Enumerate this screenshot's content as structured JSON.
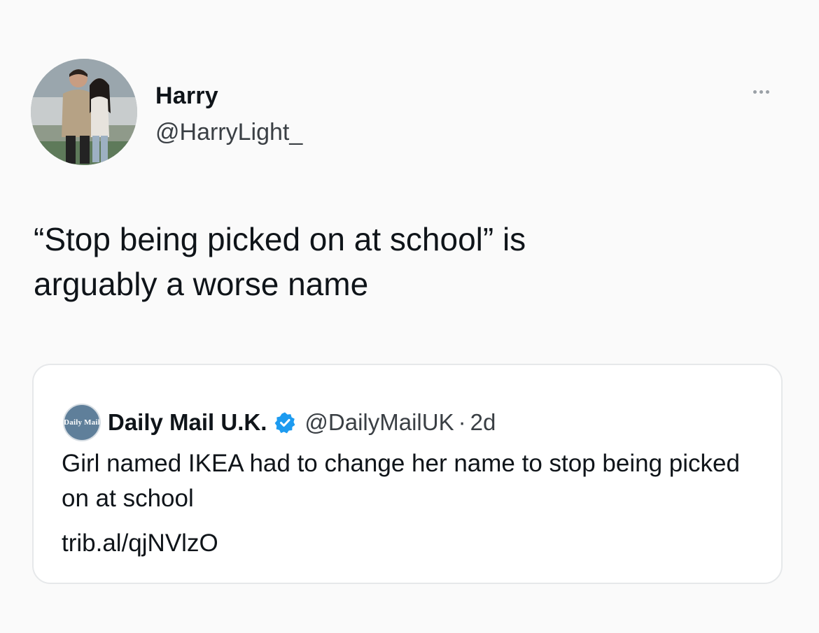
{
  "tweet": {
    "author": {
      "name": "Harry",
      "handle": "@HarryLight_"
    },
    "text": "“Stop being picked on at school” is\narguably a worse name",
    "quoted": {
      "author": {
        "name": "Daily Mail U.K.",
        "avatar_text": "Daily Mail",
        "verified": true,
        "handle": "@DailyMailUK",
        "separator": "·",
        "time": "2d"
      },
      "text": "Girl named IKEA had to change her name to stop being picked on at school",
      "link": "trib.al/qjNVlzO"
    }
  },
  "colors": {
    "background": "#fafafa",
    "text": "#0f1419",
    "secondary_text": "#3a3f44",
    "card_border": "#e6e8ea",
    "verified_badge": "#1d9bf0"
  },
  "icons": {
    "more": "more-horizontal-icon",
    "verified": "verified-badge-icon"
  }
}
